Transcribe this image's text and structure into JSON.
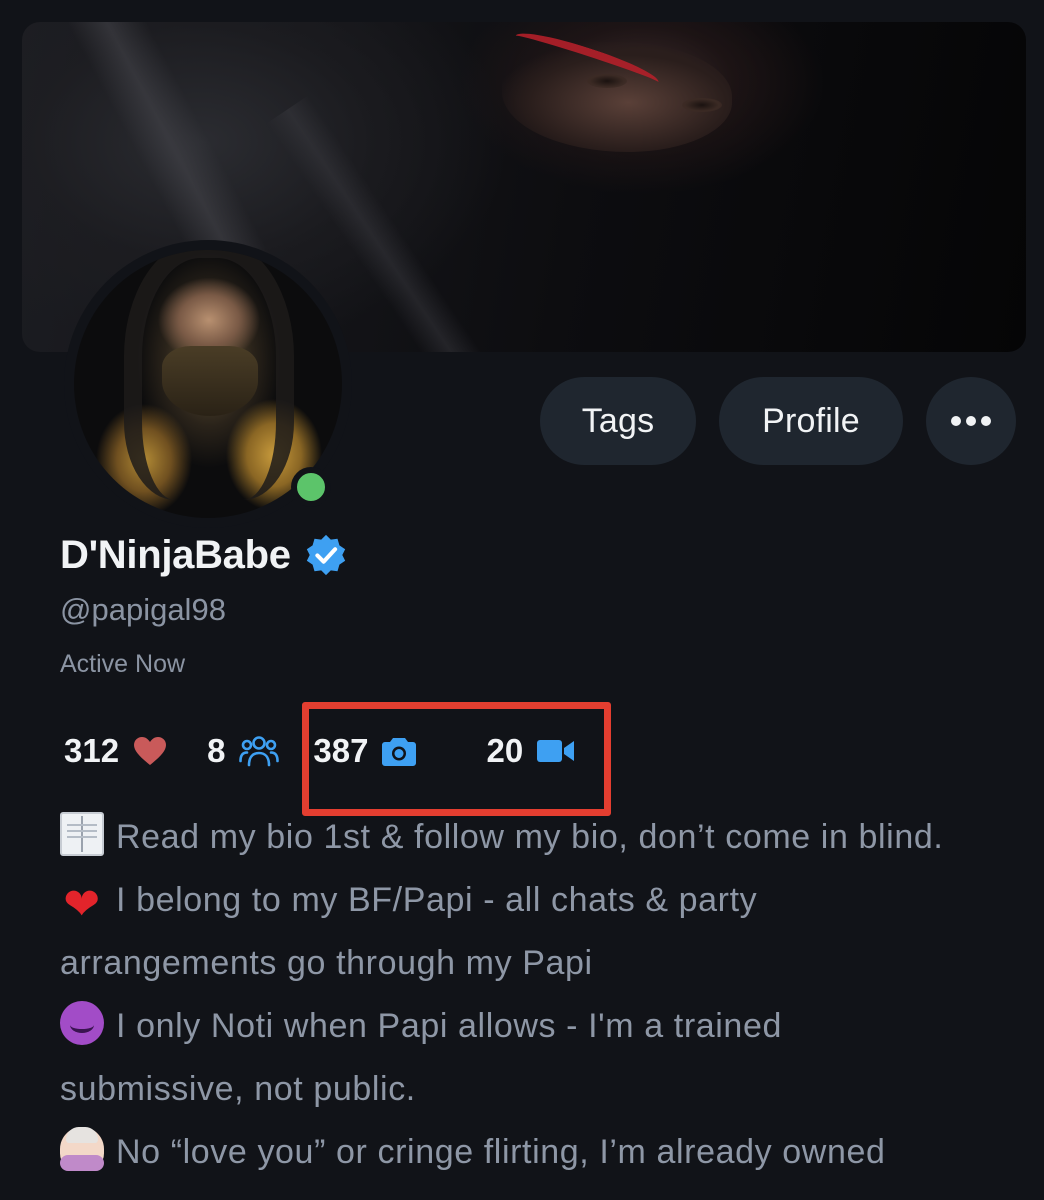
{
  "profile": {
    "display_name": "D'NinjaBabe",
    "handle": "@papigal98",
    "status": "Active Now",
    "verified": true
  },
  "actions": {
    "tags_label": "Tags",
    "profile_label": "Profile",
    "more_icon": "more-horizontal-icon"
  },
  "stats": {
    "likes": "312",
    "fans": "8",
    "photos": "387",
    "videos": "20"
  },
  "bio": [
    {
      "icon": "open-book-emoji",
      "text": "Read my bio 1st & follow my bio, don’t come in blind."
    },
    {
      "icon": "red-heart-emoji",
      "text": "I belong to my BF/Papi - all chats & party"
    },
    {
      "icon": "",
      "text": "arrangements go through my Papi"
    },
    {
      "icon": "smiling-devil-emoji",
      "text": "I only Noti when Papi allows - I'm a trained"
    },
    {
      "icon": "",
      "text": "submissive, not public."
    },
    {
      "icon": "person-gesturing-no-emoji",
      "text": "No “love you” or cringe flirting, I’m already owned"
    }
  ],
  "colors": {
    "background": "#111318",
    "button_bg": "#1f262f",
    "accent_blue": "#3ea0f2",
    "online_green": "#5cc46a",
    "highlight_red": "#e43e30",
    "heart_red": "#c95a5a"
  }
}
